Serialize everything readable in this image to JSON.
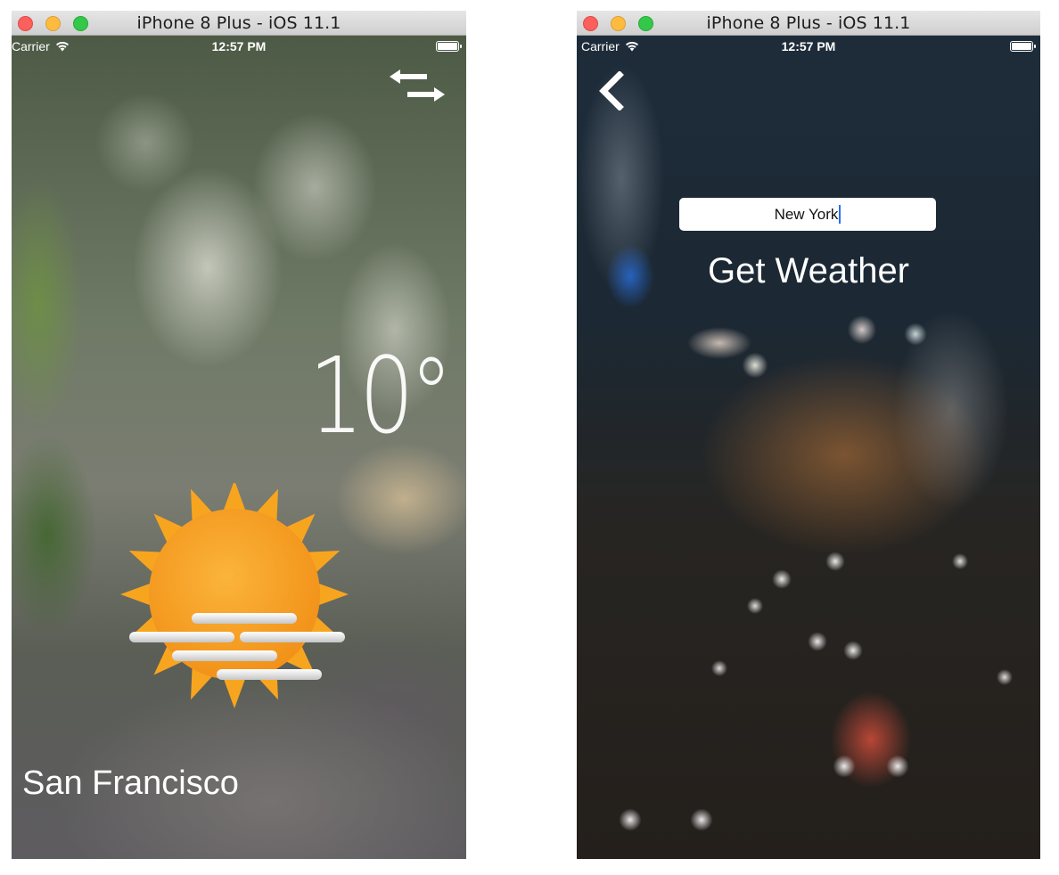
{
  "left_window": {
    "title": "iPhone 8 Plus - iOS 11.1",
    "status_bar": {
      "carrier": "Carrier",
      "time": "12:57 PM"
    },
    "temperature": "10°",
    "city": "San Francisco",
    "icons": {
      "switch": "switch-city-icon",
      "weather": "sunny-fog-icon"
    }
  },
  "right_window": {
    "title": "iPhone 8 Plus - iOS 11.1",
    "status_bar": {
      "carrier": "Carrier",
      "time": "12:57 PM"
    },
    "city_input": {
      "value": "New York"
    },
    "get_weather_label": "Get Weather",
    "icons": {
      "back": "back-chevron-icon"
    }
  },
  "colors": {
    "traffic_red": "#fc605c",
    "traffic_yellow": "#fdbc40",
    "traffic_green": "#34c84a",
    "caret": "#2a6df5",
    "sun": "#f7a51f"
  }
}
